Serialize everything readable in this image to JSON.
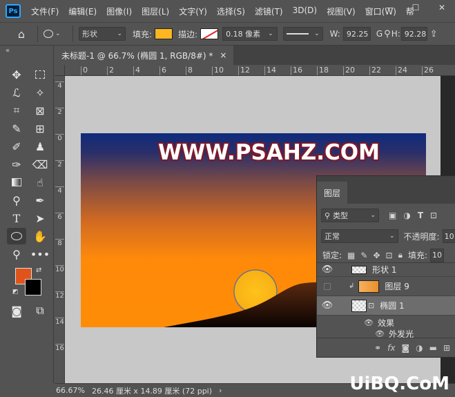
{
  "app": {
    "logo": "Ps"
  },
  "menu": [
    "文件(F)",
    "编辑(E)",
    "图像(I)",
    "图层(L)",
    "文字(Y)",
    "选择(S)",
    "滤镜(T)",
    "3D(D)",
    "视图(V)",
    "窗口(W)",
    "帮"
  ],
  "window_controls": {
    "minimize": "—",
    "maximize": "☐",
    "close": "✕"
  },
  "options": {
    "mode": "形状",
    "fill_label": "填充:",
    "fill_color": "#fbb621",
    "stroke_label": "描边:",
    "stroke_width": "0.18 像素",
    "w_label": "W:",
    "w_value": "92.25",
    "g_label": "G",
    "h_label": "H:",
    "h_value": "92.28"
  },
  "colors": {
    "foreground": "#e0531b",
    "background": "#000000"
  },
  "document": {
    "tab_title": "未标题-1 @ 66.7% (椭圆 1, RGB/8#) *",
    "tab_close": "×",
    "artboard_text": "WWW.PSAHZ.COM"
  },
  "ruler_h": [
    "0",
    "2",
    "4",
    "6",
    "8",
    "10",
    "12",
    "14",
    "16",
    "18",
    "20",
    "22",
    "24",
    "26"
  ],
  "ruler_v": [
    "4",
    "2",
    "0",
    "2",
    "4",
    "6",
    "8",
    "10",
    "12",
    "14",
    "16"
  ],
  "layers": {
    "tab": "图层",
    "filter_kind": "类型",
    "blend_mode": "正常",
    "opacity_label": "不透明度:",
    "opacity_value": "10",
    "lock_label": "锁定:",
    "fill_label": "填充:",
    "fill_value": "10",
    "rows": [
      {
        "name": "形状 1"
      },
      {
        "name": "图层 9"
      },
      {
        "name": "椭圆 1"
      },
      {
        "name": "效果"
      },
      {
        "name": "外发光"
      }
    ]
  },
  "status": {
    "zoom": "66.67%",
    "doc_size": "26.46 厘米 x 14.89 厘米 (72 ppi)",
    "arrow": "›"
  },
  "watermark": "UiBQ.CoM"
}
